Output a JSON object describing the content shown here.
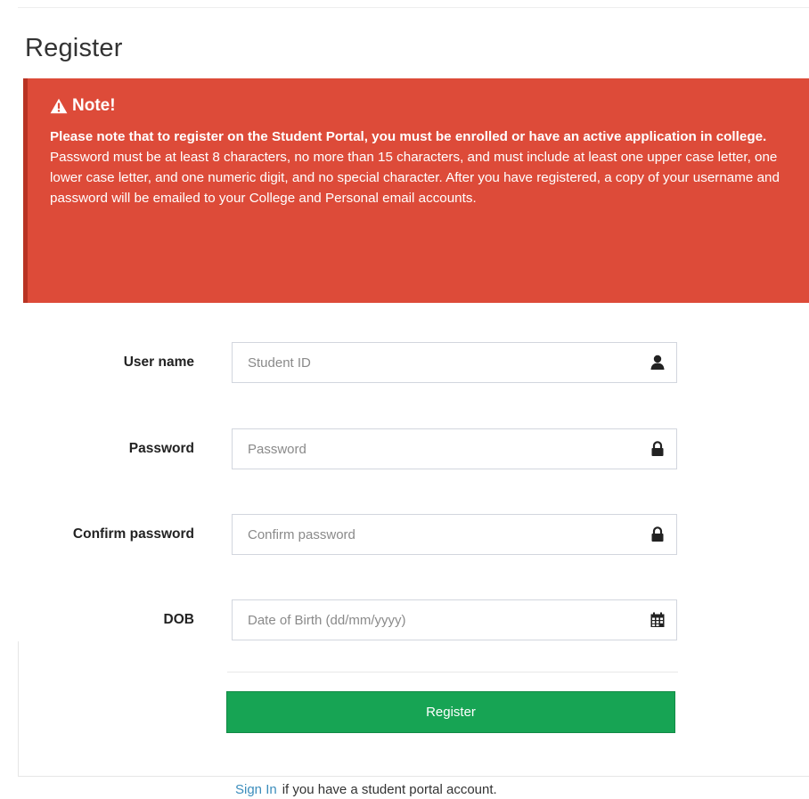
{
  "page": {
    "title": "Register"
  },
  "alert": {
    "heading": "Note!",
    "strong_text": "Please note that to register on the Student Portal, you must be enrolled or have an active application in college.",
    "body_text": "Password must be at least 8 characters, no more than 15 characters, and must include at least one upper case letter, one lower case letter, and one numeric digit, and no special character. After you have registered, a copy of your username and password will be emailed to your College and Personal email accounts.",
    "icon": "warning-triangle-icon",
    "background_color": "#dd4b39"
  },
  "form": {
    "fields": [
      {
        "label": "User name",
        "placeholder": "Student ID",
        "value": "",
        "icon": "user-icon"
      },
      {
        "label": "Password",
        "placeholder": "Password",
        "value": "",
        "icon": "lock-icon"
      },
      {
        "label": "Confirm password",
        "placeholder": "Confirm password",
        "value": "",
        "icon": "lock-icon"
      },
      {
        "label": "DOB",
        "placeholder": "Date of Birth (dd/mm/yyyy)",
        "value": "",
        "icon": "calendar-icon"
      }
    ],
    "submit_label": "Register",
    "submit_color": "#17a454"
  },
  "footer": {
    "signin_link": "Sign In",
    "signin_text": "if you have a student portal account.",
    "link_color": "#3c8dbc"
  }
}
